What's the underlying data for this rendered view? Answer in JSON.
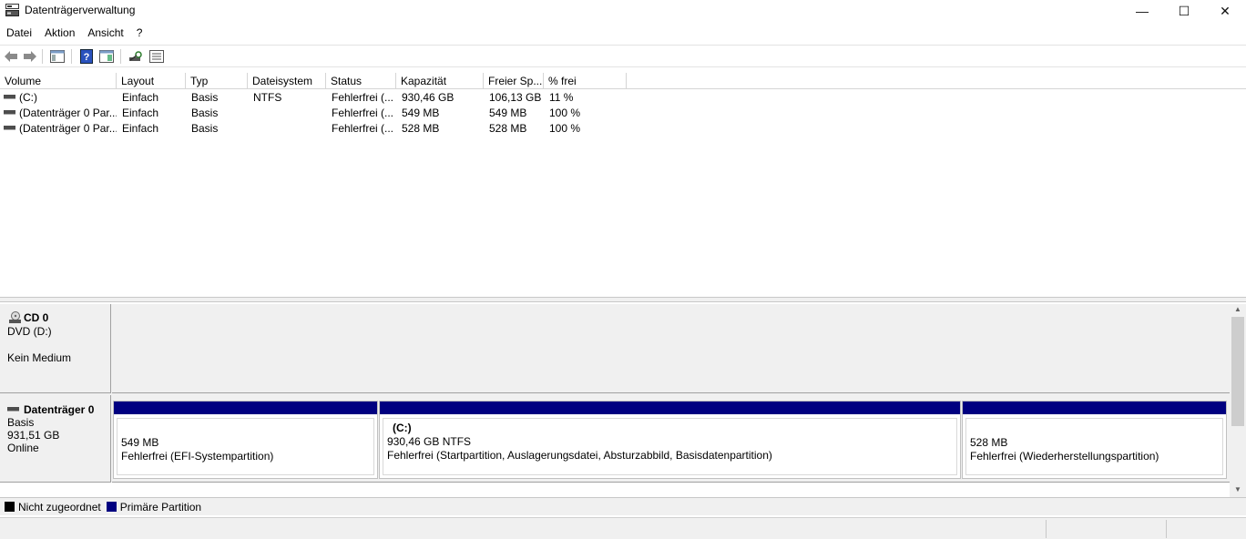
{
  "window": {
    "title": "Datenträgerverwaltung",
    "minimize": "—",
    "maximize": "☐",
    "close": "✕"
  },
  "menu": [
    "Datei",
    "Aktion",
    "Ansicht",
    "?"
  ],
  "toolbar": {
    "icons": [
      "back-arrow-icon",
      "forward-arrow-icon",
      "console-tree-icon",
      "help-icon",
      "properties-icon",
      "rescan-icon",
      "list-view-icon"
    ]
  },
  "volume_list": {
    "columns": [
      "Volume",
      "Layout",
      "Typ",
      "Dateisystem",
      "Status",
      "Kapazität",
      "Freier Sp...",
      "% frei"
    ],
    "rows": [
      {
        "volume": "(C:)",
        "layout": "Einfach",
        "typ": "Basis",
        "fs": "NTFS",
        "status": "Fehlerfrei (...",
        "capacity": "930,46 GB",
        "free": "106,13 GB",
        "pct": "11 %"
      },
      {
        "volume": "(Datenträger 0 Par...",
        "layout": "Einfach",
        "typ": "Basis",
        "fs": "",
        "status": "Fehlerfrei (...",
        "capacity": "549 MB",
        "free": "549 MB",
        "pct": "100 %"
      },
      {
        "volume": "(Datenträger 0 Par...",
        "layout": "Einfach",
        "typ": "Basis",
        "fs": "",
        "status": "Fehlerfrei (...",
        "capacity": "528 MB",
        "free": "528 MB",
        "pct": "100 %"
      }
    ]
  },
  "disks": {
    "cd": {
      "name": "CD 0",
      "drive": "DVD (D:)",
      "state": "Kein Medium"
    },
    "disk0": {
      "name": "Datenträger 0",
      "type": "Basis",
      "size": "931,51 GB",
      "state": "Online",
      "partitions": [
        {
          "title": "",
          "size": "549 MB",
          "status": "Fehlerfrei (EFI-Systempartition)"
        },
        {
          "title": "(C:)",
          "size": "930,46 GB NTFS",
          "status": "Fehlerfrei (Startpartition, Auslagerungsdatei, Absturzabbild, Basisdatenpartition)"
        },
        {
          "title": "",
          "size": "528 MB",
          "status": "Fehlerfrei (Wiederherstellungspartition)"
        }
      ]
    }
  },
  "legend": {
    "unallocated": {
      "label": "Nicht zugeordnet",
      "color": "#000000"
    },
    "primary": {
      "label": "Primäre Partition",
      "color": "#000080"
    }
  }
}
